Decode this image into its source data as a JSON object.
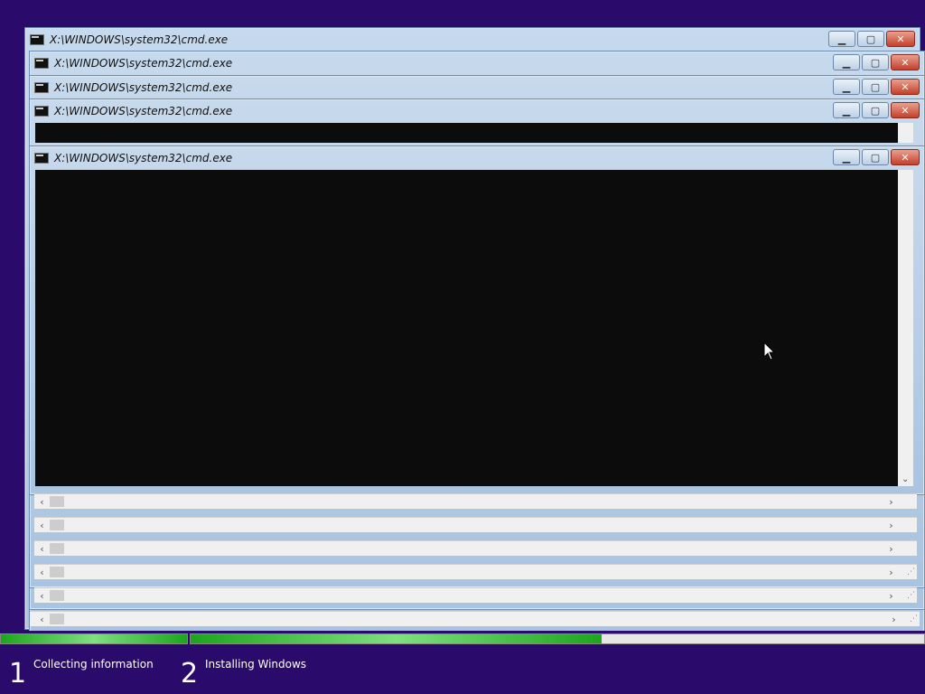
{
  "windows": [
    {
      "title": "X:\\WINDOWS\\system32\\cmd.exe"
    },
    {
      "title": "X:\\WINDOWS\\system32\\cmd.exe"
    },
    {
      "title": "X:\\WINDOWS\\system32\\cmd.exe"
    },
    {
      "title": "X:\\WINDOWS\\system32\\cmd.exe"
    },
    {
      "title": "X:\\WINDOWS\\system32\\cmd.exe"
    }
  ],
  "setup": {
    "steps": [
      {
        "number": "1",
        "label": "Collecting information",
        "progress": 1.0
      },
      {
        "number": "2",
        "label": "Installing Windows",
        "progress": 0.56
      }
    ]
  },
  "colors": {
    "desktop": "#2a0a6b",
    "console": "#0c0c0c",
    "progress": "#1da51d"
  },
  "icons": [
    "cmd-icon",
    "minimize-icon",
    "maximize-icon",
    "close-icon",
    "scroll-left-icon",
    "scroll-right-icon",
    "scroll-down-icon",
    "mouse-cursor-icon"
  ]
}
